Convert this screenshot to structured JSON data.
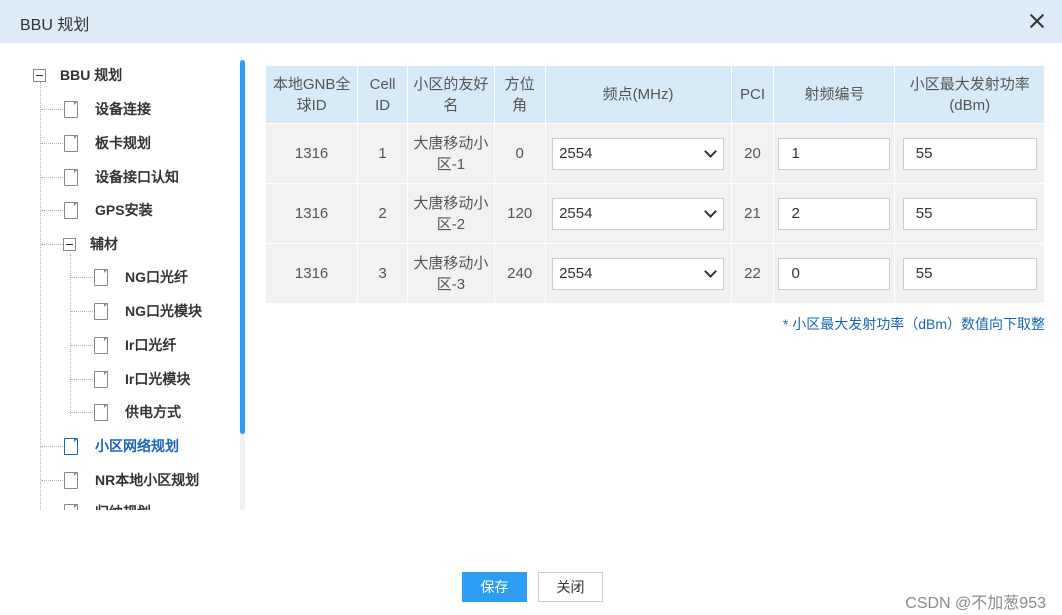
{
  "dialog": {
    "title": "BBU 规划"
  },
  "tree": {
    "root": "BBU 规划",
    "items": [
      "设备连接",
      "板卡规划",
      "设备接口认知",
      "GPS安装"
    ],
    "group": "辅材",
    "group_items": [
      "NG口光纤",
      "NG口光模块",
      "Ir口光纤",
      "Ir口光模块",
      "供电方式"
    ],
    "after": [
      "小区网络规划",
      "NR本地小区规划"
    ],
    "partial": "归纳规划",
    "active_label": "小区网络规划"
  },
  "table": {
    "headers": [
      "本地GNB全球ID",
      "Cell ID",
      "小区的友好名",
      "方位角",
      "频点(MHz)",
      "PCI",
      "射频编号",
      "小区最大发射功率(dBm)"
    ],
    "rows": [
      {
        "gnb_id": "1316",
        "cell_id": "1",
        "name": "大唐移动小区-1",
        "azimuth": "0",
        "freq": "2554",
        "pci": "20",
        "rf": "1",
        "power": "55"
      },
      {
        "gnb_id": "1316",
        "cell_id": "2",
        "name": "大唐移动小区-2",
        "azimuth": "120",
        "freq": "2554",
        "pci": "21",
        "rf": "2",
        "power": "55"
      },
      {
        "gnb_id": "1316",
        "cell_id": "3",
        "name": "大唐移动小区-3",
        "azimuth": "240",
        "freq": "2554",
        "pci": "22",
        "rf": "0",
        "power": "55"
      }
    ]
  },
  "note": "* 小区最大发射功率（dBm）数值向下取整",
  "buttons": {
    "save": "保存",
    "close": "关闭"
  },
  "watermark": "CSDN @不加葱953",
  "colors": {
    "title_bar": "#ddebf9",
    "accent": "#2e9ef4",
    "active_text": "#1b66b3",
    "header_bg": "#d6eaf8",
    "cell_bg": "#f2f2f2"
  }
}
